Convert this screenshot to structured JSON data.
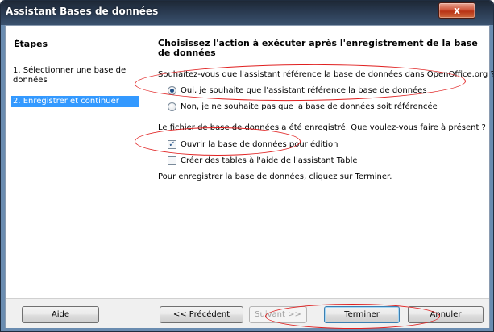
{
  "window": {
    "title": "Assistant Bases de données",
    "close_glyph": "x"
  },
  "steps": {
    "heading": "Étapes",
    "items": [
      {
        "label": "1. Sélectionner une base de données",
        "selected": false
      },
      {
        "label": "2. Enregistrer et continuer",
        "selected": true
      }
    ]
  },
  "content": {
    "title": "Choisissez l'action à exécuter après l'enregistrement de la base de données",
    "question_register": "Souhaitez-vous que l'assistant référence la base de données dans OpenOffice.org ?",
    "radio_yes": {
      "label": "Oui, je souhaite que l'assistant référence la base de données",
      "checked": true
    },
    "radio_no": {
      "label": "Non, je ne souhaite pas que la base de données soit référencée",
      "checked": false
    },
    "question_next": "Le fichier de base de données a été enregistré. Que voulez-vous faire à présent ?",
    "check_open": {
      "label": "Ouvrir la base de données pour édition",
      "checked": true,
      "mark": "✓"
    },
    "check_tables": {
      "label": "Créer des tables à l'aide de l'assistant Table",
      "checked": false
    },
    "finish_note": "Pour enregistrer la base de données, cliquez sur Terminer."
  },
  "buttons": {
    "help": "Aide",
    "previous": "<< Précédent",
    "next": "Suivant >>",
    "finish": "Terminer",
    "cancel": "Annuler"
  },
  "colors": {
    "selection": "#3399ff",
    "annotation": "#e02020"
  }
}
